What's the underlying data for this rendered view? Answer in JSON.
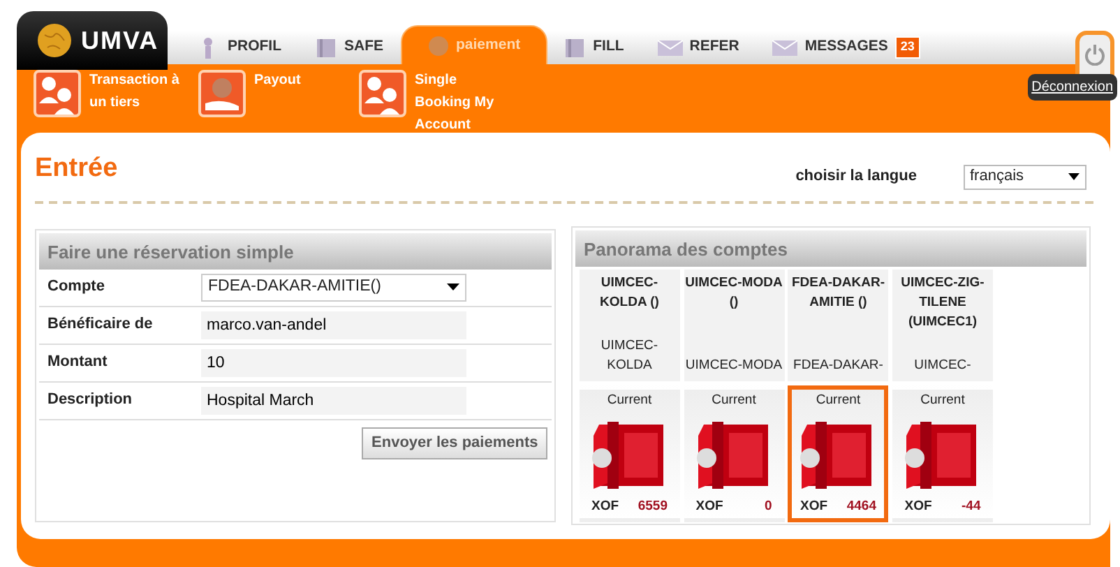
{
  "logo": {
    "text": "UMVA"
  },
  "tabs": [
    {
      "label": "PROFIL",
      "kind": "person",
      "selected": false
    },
    {
      "label": "SAFE",
      "kind": "book",
      "selected": false
    },
    {
      "label": "paiement",
      "kind": "coin",
      "selected": true
    },
    {
      "label": "FILL",
      "kind": "book",
      "selected": false
    },
    {
      "label": "REFER",
      "kind": "mail",
      "selected": false
    },
    {
      "label": "MESSAGES",
      "kind": "mail",
      "selected": false,
      "badge": "23"
    }
  ],
  "logout": {
    "tooltip": "Déconnexion"
  },
  "subnav": [
    {
      "label": "Transaction à un tiers",
      "kind": "people"
    },
    {
      "label": "Payout",
      "kind": "hand"
    },
    {
      "label": "Single Booking My Account",
      "kind": "people"
    }
  ],
  "page_title": "Entrée",
  "language": {
    "label": "choisir la langue",
    "value": "français"
  },
  "booking_form": {
    "title": "Faire une réservation simple",
    "fields": [
      {
        "label": "Compte",
        "kind": "select",
        "value": "FDEA-DAKAR-AMITIE()"
      },
      {
        "label": "Bénéficaire de",
        "kind": "text",
        "value": "marco.van-andel"
      },
      {
        "label": "Montant",
        "kind": "text",
        "value": "10"
      },
      {
        "label": "Description",
        "kind": "text",
        "value": "Hospital March"
      }
    ],
    "submit": "Envoyer les paiements"
  },
  "accounts_panel": {
    "title": "Panorama des comptes",
    "accounts": [
      {
        "name": "UIMCEC-KOLDA ()",
        "short_name": "UIMCEC-KOLDA",
        "type": "Current",
        "currency": "XOF",
        "balance": "6559",
        "selected": false
      },
      {
        "name": "UIMCEC-MODA ()",
        "short_name": "UIMCEC-MODA",
        "type": "Current",
        "currency": "XOF",
        "balance": "0",
        "selected": false
      },
      {
        "name": "FDEA-DAKAR-AMITIE ()",
        "short_name": "FDEA-DAKAR-",
        "type": "Current",
        "currency": "XOF",
        "balance": "4464",
        "selected": true
      },
      {
        "name": "UIMCEC-ZIG-TILENE (UIMCEC1)",
        "short_name": "UIMCEC-",
        "type": "Current",
        "currency": "XOF",
        "balance": "-44",
        "selected": false
      }
    ]
  }
}
